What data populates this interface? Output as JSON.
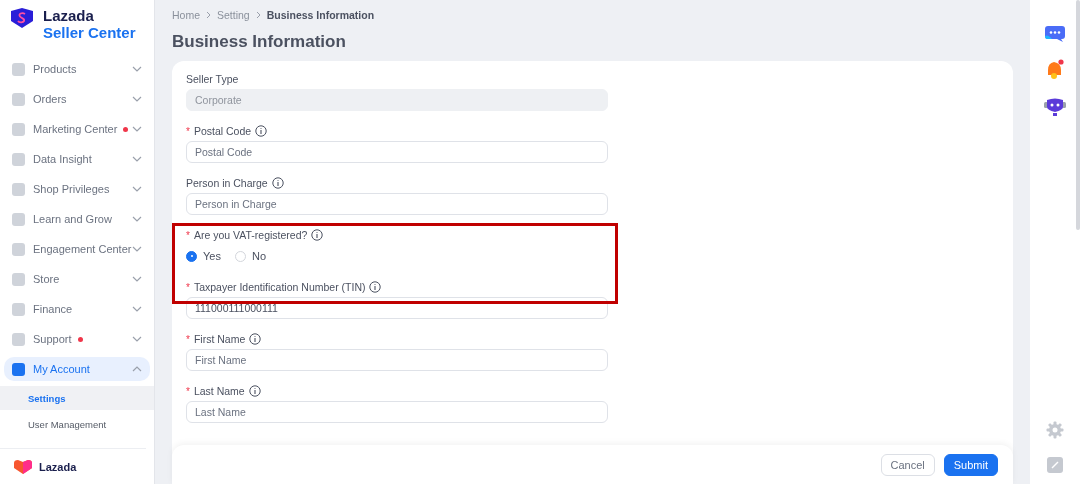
{
  "sidebar": {
    "logo": {
      "title": "Lazada",
      "subtitle": "Seller Center"
    },
    "items": [
      {
        "label": "Products",
        "dot": false,
        "expanded": false,
        "selected": false
      },
      {
        "label": "Orders",
        "dot": false,
        "expanded": false,
        "selected": false
      },
      {
        "label": "Marketing Center",
        "dot": true,
        "expanded": false,
        "selected": false
      },
      {
        "label": "Data Insight",
        "dot": false,
        "expanded": false,
        "selected": false
      },
      {
        "label": "Shop Privileges",
        "dot": false,
        "expanded": false,
        "selected": false
      },
      {
        "label": "Learn and Grow",
        "dot": false,
        "expanded": false,
        "selected": false
      },
      {
        "label": "Engagement Center",
        "dot": false,
        "expanded": false,
        "selected": false
      },
      {
        "label": "Store",
        "dot": false,
        "expanded": false,
        "selected": false
      },
      {
        "label": "Finance",
        "dot": false,
        "expanded": false,
        "selected": false
      },
      {
        "label": "Support",
        "dot": true,
        "expanded": false,
        "selected": false
      },
      {
        "label": "My Account",
        "dot": false,
        "expanded": true,
        "selected": true,
        "children": [
          {
            "label": "Settings",
            "selected": true
          },
          {
            "label": "User Management",
            "selected": false
          }
        ]
      }
    ],
    "footer_logo": "Lazada"
  },
  "breadcrumb": [
    "Home",
    "Setting",
    "Business Information"
  ],
  "page_title": "Business Information",
  "fields": [
    {
      "kind": "input",
      "label": "Seller Type",
      "info": false,
      "value": "Corporate",
      "disabled": true
    },
    {
      "kind": "input",
      "asterisk": "*",
      "label": "Postal Code",
      "info": true,
      "placeholder": "Postal Code",
      "disabled": false
    },
    {
      "kind": "input",
      "label": "Person in Charge",
      "info": true,
      "placeholder": "Person in Charge",
      "disabled": false
    },
    {
      "kind": "radio",
      "asterisk": "*",
      "label": "Are you VAT-registered?",
      "info": true,
      "options": [
        {
          "label": "Yes",
          "selected": true
        },
        {
          "label": "No",
          "selected": false
        }
      ]
    },
    {
      "kind": "input",
      "asterisk": "*",
      "label": "Taxpayer Identification Number (TIN)",
      "info": true,
      "value": "111000111000111",
      "disabled": false
    },
    {
      "kind": "input",
      "asterisk": "*",
      "label": "First Name",
      "info": true,
      "placeholder": "First Name",
      "disabled": false
    },
    {
      "kind": "input",
      "asterisk": "*",
      "label": "Last Name",
      "info": true,
      "placeholder": "Last Name",
      "disabled": false
    }
  ],
  "buttons": [
    {
      "label": "Cancel",
      "kind": "secondary"
    },
    {
      "label": "Submit",
      "kind": "primary"
    }
  ]
}
